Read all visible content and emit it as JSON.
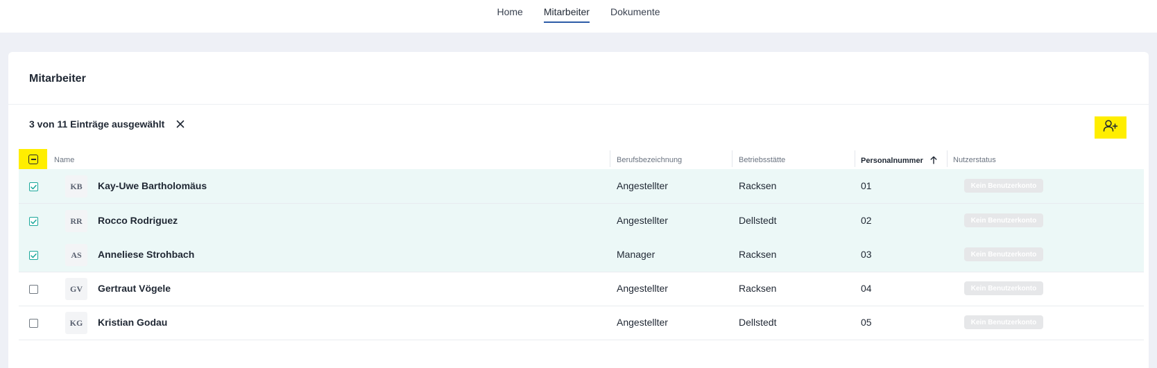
{
  "nav": {
    "links": [
      {
        "label": "Home",
        "active": false
      },
      {
        "label": "Mitarbeiter",
        "active": true
      },
      {
        "label": "Dokumente",
        "active": false
      }
    ]
  },
  "card": {
    "title": "Mitarbeiter"
  },
  "selection": {
    "text": "3 von 11 Einträge ausgewählt",
    "close_icon": "close-icon"
  },
  "toolbar": {
    "add_user_icon": "user-plus-icon"
  },
  "table": {
    "columns": {
      "name": "Name",
      "job": "Berufsbezeichnung",
      "site": "Betriebsstätte",
      "number": "Personalnummer",
      "status": "Nutzerstatus"
    },
    "sort": {
      "column": "Personalnummer",
      "direction": "ascending"
    },
    "rows": [
      {
        "initials": "KB",
        "name": "Kay-Uwe Bartholomäus",
        "job": "Angestellter",
        "site": "Racksen",
        "number": "01",
        "status": "Kein Benutzerkonto",
        "selected": true
      },
      {
        "initials": "RR",
        "name": "Rocco Rodriguez",
        "job": "Angestellter",
        "site": "Dellstedt",
        "number": "02",
        "status": "Kein Benutzerkonto",
        "selected": true
      },
      {
        "initials": "AS",
        "name": "Anneliese Strohbach",
        "job": "Manager",
        "site": "Racksen",
        "number": "03",
        "status": "Kein Benutzerkonto",
        "selected": true
      },
      {
        "initials": "GV",
        "name": "Gertraut Vögele",
        "job": "Angestellter",
        "site": "Racksen",
        "number": "04",
        "status": "Kein Benutzerkonto",
        "selected": false
      },
      {
        "initials": "KG",
        "name": "Kristian Godau",
        "job": "Angestellter",
        "site": "Dellstedt",
        "number": "05",
        "status": "Kein Benutzerkonto",
        "selected": false
      }
    ]
  },
  "colors": {
    "accent": "#19a79a",
    "selected_row": "#ecf8f7",
    "highlight": "#ffee00",
    "nav_underline": "#2b5aa6"
  }
}
